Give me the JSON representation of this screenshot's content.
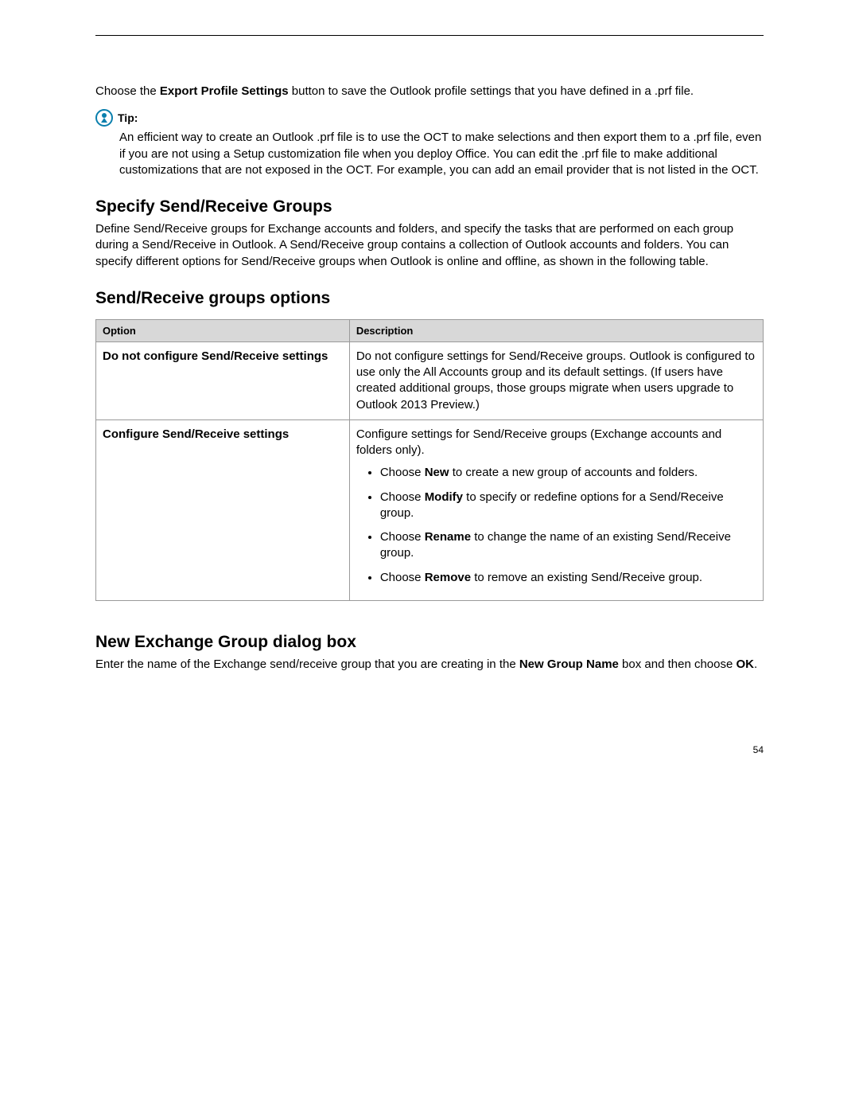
{
  "intro": {
    "pre": "Choose the ",
    "bold": "Export Profile Settings",
    "post": " button to save the Outlook profile settings that you have defined in a .prf file."
  },
  "tip": {
    "label": "Tip:",
    "body": "An efficient way to create an Outlook .prf file is to use the OCT to make selections and then export them to a .prf file, even if you are not using a Setup customization file when you deploy Office. You can edit the .prf file to make additional customizations that are not exposed in the OCT. For example, you can add an email provider that is not listed in the OCT."
  },
  "section1": {
    "heading": "Specify Send/Receive Groups",
    "body": "Define Send/Receive groups for Exchange accounts and folders, and specify the tasks that are performed on each group during a Send/Receive in Outlook. A Send/Receive group contains a collection of Outlook accounts and folders. You can specify different options for Send/Receive groups when Outlook is online and offline, as shown in the following table."
  },
  "section2": {
    "heading": "Send/Receive groups options"
  },
  "table": {
    "headers": {
      "c1": "Option",
      "c2": "Description"
    },
    "row1": {
      "option": "Do not configure Send/Receive settings",
      "desc": "Do not configure settings for Send/Receive groups. Outlook is configured to use only the All Accounts group and its default settings. (If users have created additional groups, those groups migrate when users upgrade to Outlook 2013 Preview.)"
    },
    "row2": {
      "option": "Configure Send/Receive settings",
      "lead": "Configure settings for Send/Receive groups (Exchange accounts and folders only).",
      "b1": {
        "pre": "Choose ",
        "bold": "New",
        "post": " to create a new group of accounts and folders."
      },
      "b2": {
        "pre": "Choose ",
        "bold": "Modify",
        "post": " to specify or redefine options for a Send/Receive group."
      },
      "b3": {
        "pre": "Choose ",
        "bold": "Rename",
        "post": " to change the name of an existing Send/Receive group."
      },
      "b4": {
        "pre": "Choose ",
        "bold": "Remove",
        "post": " to remove an existing Send/Receive group."
      }
    }
  },
  "section3": {
    "heading": "New Exchange Group dialog box",
    "p": {
      "pre": "Enter the name of the Exchange send/receive group that you are creating in the ",
      "bold1": "New Group Name",
      "mid": " box and then choose ",
      "bold2": "OK",
      "post": "."
    }
  },
  "page_number": "54"
}
